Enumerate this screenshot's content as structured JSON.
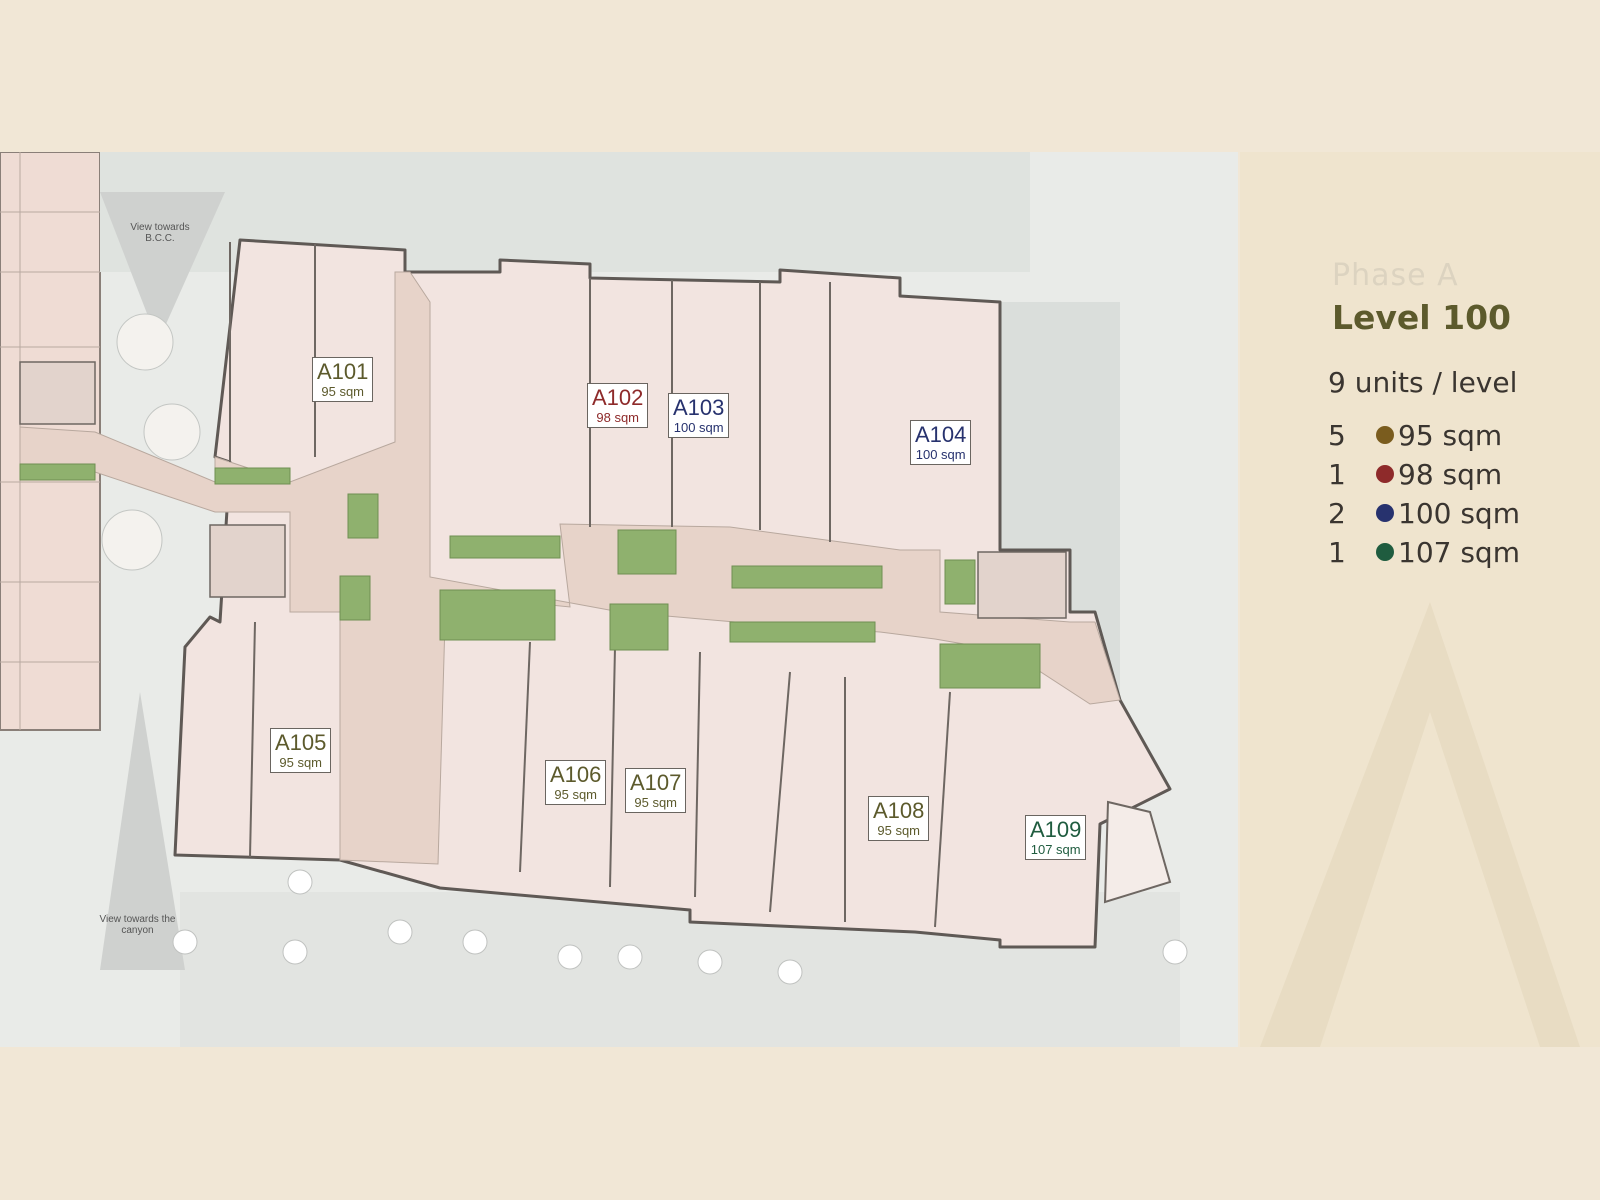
{
  "header": {
    "phase": "Phase A",
    "level": "Level 100"
  },
  "summary": {
    "units_per_level": "9 units / level"
  },
  "legend": [
    {
      "count": "5",
      "area": "95 sqm",
      "color": "#7a5c1e"
    },
    {
      "count": "1",
      "area": "98 sqm",
      "color": "#8e2a2a"
    },
    {
      "count": "2",
      "area": "100 sqm",
      "color": "#27326e"
    },
    {
      "count": "1",
      "area": "107 sqm",
      "color": "#1f5c3f"
    }
  ],
  "units": [
    {
      "code": "A101",
      "area": "95 sqm",
      "color": "#5c5a2c"
    },
    {
      "code": "A102",
      "area": "98 sqm",
      "color": "#8e2a2a"
    },
    {
      "code": "A103",
      "area": "100 sqm",
      "color": "#27326e"
    },
    {
      "code": "A104",
      "area": "100 sqm",
      "color": "#27326e"
    },
    {
      "code": "A105",
      "area": "95 sqm",
      "color": "#5c5a2c"
    },
    {
      "code": "A106",
      "area": "95 sqm",
      "color": "#5c5a2c"
    },
    {
      "code": "A107",
      "area": "95 sqm",
      "color": "#5c5a2c"
    },
    {
      "code": "A108",
      "area": "95 sqm",
      "color": "#5c5a2c"
    },
    {
      "code": "A109",
      "area": "107 sqm",
      "color": "#1f5c3f"
    }
  ],
  "notes": {
    "view_bcc": "View towards B.C.C.",
    "view_canyon": "View towards the canyon"
  }
}
